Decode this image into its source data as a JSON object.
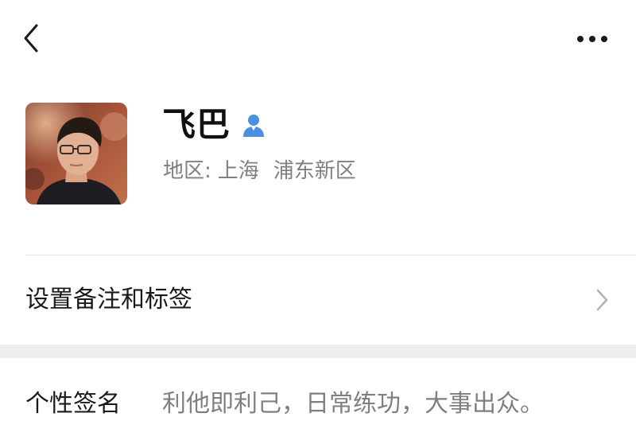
{
  "profile": {
    "name": "飞巴",
    "region_label": "地区:",
    "region_city": "上海",
    "region_district": "浦东新区",
    "gender_icon": "male-user-icon"
  },
  "colors": {
    "accent_blue": "#4a8fe0",
    "text_primary": "#1a1a1a",
    "text_secondary": "#7f7f7f",
    "divider": "#e6e6e6",
    "section_bg": "#ededed"
  },
  "remark_row": {
    "label": "设置备注和标签"
  },
  "signature_row": {
    "label": "个性签名",
    "value": "利他即利己，日常练功，大事出众。"
  },
  "topbar": {
    "back_icon": "chevron-left-icon",
    "more_icon": "more-dots-icon"
  }
}
